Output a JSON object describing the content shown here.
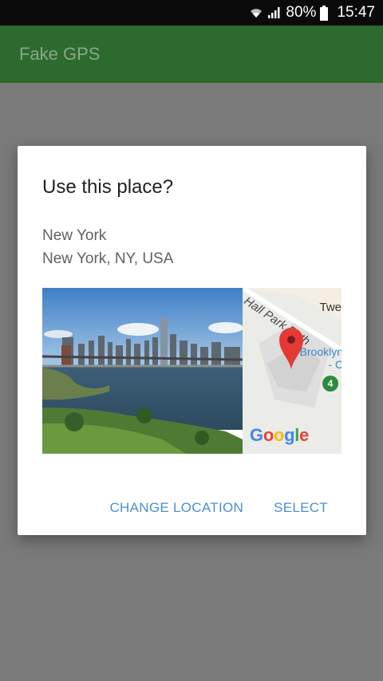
{
  "status_bar": {
    "battery": "80%",
    "time": "15:47",
    "icons": [
      "wifi-icon",
      "signal-icon",
      "battery-icon"
    ]
  },
  "app_bar": {
    "title": "Fake GPS",
    "color": "#2d6a2d"
  },
  "dialog": {
    "title": "Use this place?",
    "place_name": "New York",
    "place_address": "New York, NY, USA",
    "map": {
      "road_label": "Hall Park Path",
      "label_tweed": "Twe",
      "label_brooklyn_1": "Brooklyn",
      "label_brooklyn_2": "- C",
      "subway_badge": "4",
      "logo_text": "Google"
    },
    "actions": {
      "change_location": "CHANGE LOCATION",
      "select": "SELECT"
    },
    "accent_color": "#4a8ed8"
  }
}
